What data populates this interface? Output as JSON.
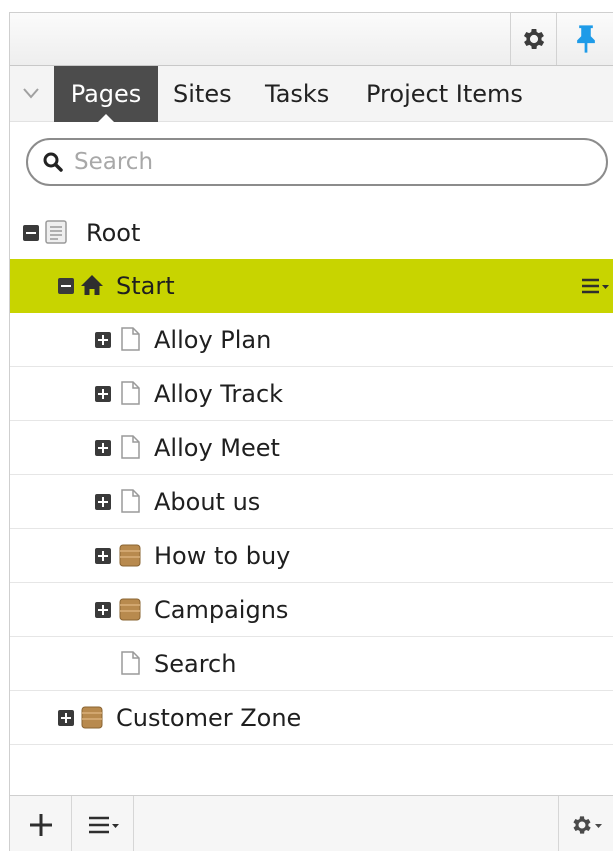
{
  "toolbar": {
    "settings_icon": "gear-icon",
    "pin_icon": "pin-icon",
    "pin_color": "#1e9be8"
  },
  "tabs": [
    {
      "label": "Pages",
      "active": true
    },
    {
      "label": "Sites",
      "active": false
    },
    {
      "label": "Tasks",
      "active": false
    },
    {
      "label": "Project Items",
      "active": false
    }
  ],
  "search": {
    "placeholder": "Search",
    "value": ""
  },
  "tree": {
    "root": {
      "label": "Root",
      "icon": "root-page-icon",
      "expanded": true
    },
    "start": {
      "label": "Start",
      "icon": "home-icon",
      "expanded": true,
      "selected": true
    },
    "children": [
      {
        "label": "Alloy Plan",
        "icon": "page-icon",
        "expandable": true
      },
      {
        "label": "Alloy Track",
        "icon": "page-icon",
        "expandable": true
      },
      {
        "label": "Alloy Meet",
        "icon": "page-icon",
        "expandable": true
      },
      {
        "label": "About us",
        "icon": "page-icon",
        "expandable": true
      },
      {
        "label": "How to buy",
        "icon": "container-icon",
        "expandable": true
      },
      {
        "label": "Campaigns",
        "icon": "container-icon",
        "expandable": true
      },
      {
        "label": "Search",
        "icon": "page-icon",
        "expandable": false
      }
    ],
    "customer_zone": {
      "label": "Customer Zone",
      "icon": "container-icon",
      "expandable": true
    }
  },
  "colors": {
    "selected_row": "#c8d400",
    "active_tab": "#4c4c4c",
    "container": "#b88a4e"
  }
}
